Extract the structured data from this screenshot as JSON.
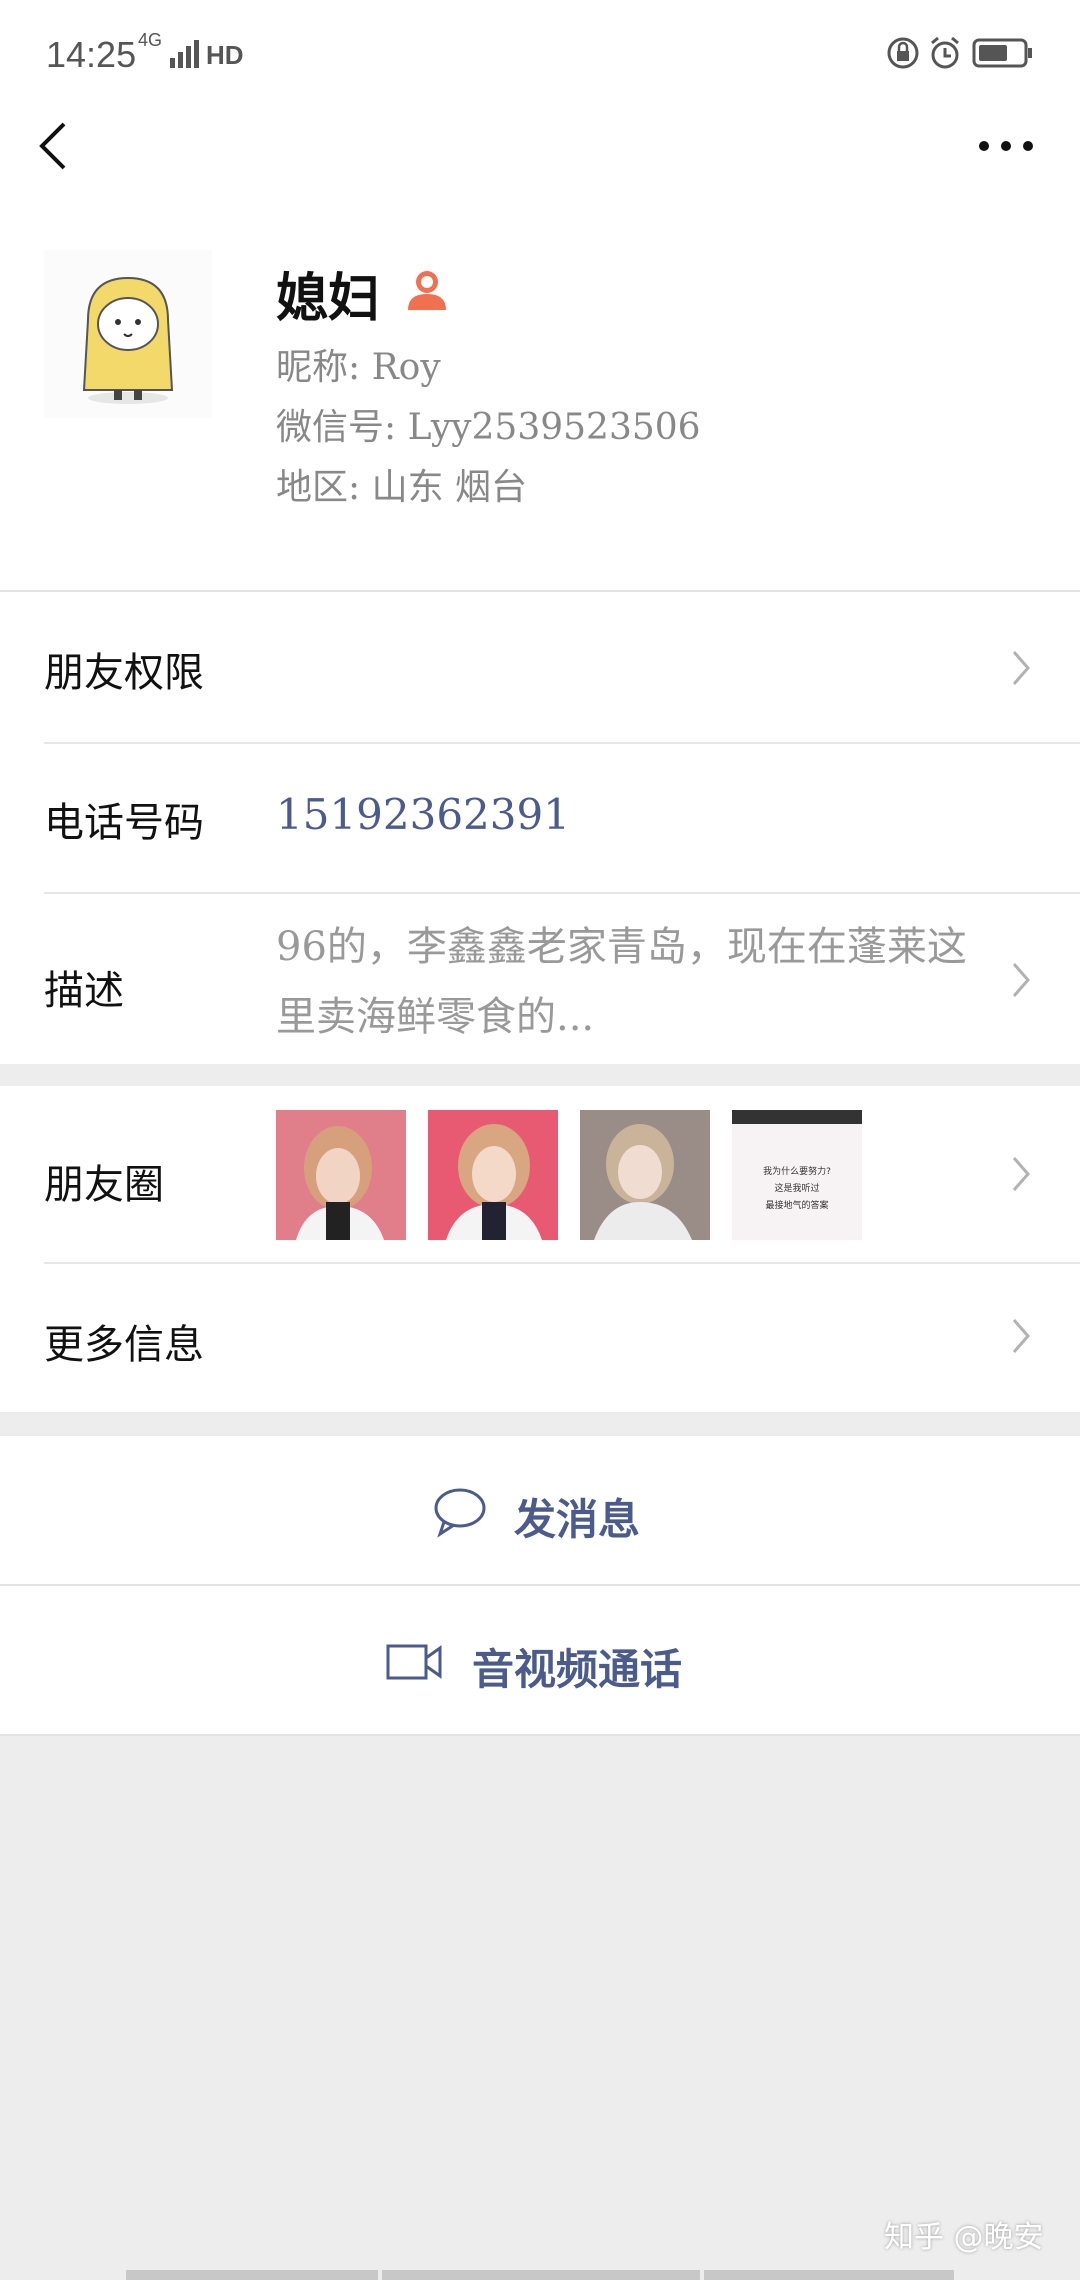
{
  "status_bar": {
    "time": "14:25",
    "network": "4G",
    "hd": "HD"
  },
  "profile": {
    "name": "媳妇",
    "nickname": "昵称: Roy",
    "wechat_id": "微信号: Lyy2539523506",
    "region": "地区: 山东 烟台"
  },
  "rows": {
    "permissions_label": "朋友权限",
    "phone_label": "电话号码",
    "phone_value": "15192362391",
    "desc_label": "描述",
    "desc_value": "96的，李鑫鑫老家青岛，现在在蓬莱这里卖海鲜零食的...",
    "moments_label": "朋友圈",
    "more_label": "更多信息"
  },
  "moments_thumb_text": [
    "我为什么要努力?",
    "这是我听过",
    "最接地气的答案"
  ],
  "actions": {
    "message": "发消息",
    "video_call": "音视频通话"
  },
  "watermark": "知乎 @晚安",
  "colors": {
    "link_blue": "#4a5b8c",
    "background": "#ededed",
    "person_badge": "#f07050"
  }
}
